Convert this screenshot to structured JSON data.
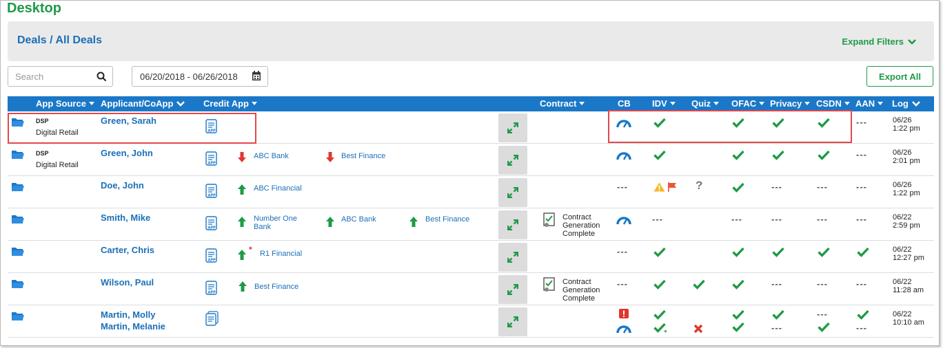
{
  "page_title": "Desktop",
  "breadcrumb": "Deals / All Deals",
  "expand_filters": "Expand Filters",
  "search_placeholder": "Search",
  "date_range": "06/20/2018 - 06/26/2018",
  "export_label": "Export All",
  "columns": {
    "app_source": "App Source",
    "applicant": "Applicant/CoApp",
    "credit_app": "Credit App",
    "contract": "Contract",
    "cb": "CB",
    "idv": "IDV",
    "quiz": "Quiz",
    "ofac": "OFAC",
    "privacy": "Privacy",
    "csdn": "CSDN",
    "aan": "AAN",
    "log": "Log"
  },
  "rows": [
    {
      "source_top": "DSP",
      "source_bottom": "Digital Retail",
      "name": "Green, Sarah",
      "name2": "",
      "lenders": [],
      "contract": "",
      "log_date": "06/26",
      "log_time": "1:22 pm"
    },
    {
      "source_top": "DSP",
      "source_bottom": "Digital Retail",
      "name": "Green, John",
      "name2": "",
      "lenders": [
        {
          "dir": "down",
          "name": "ABC Bank"
        },
        {
          "dir": "down",
          "name": "Best Finance"
        }
      ],
      "contract": "",
      "log_date": "06/26",
      "log_time": "2:01 pm"
    },
    {
      "source_top": "",
      "source_bottom": "",
      "name": "Doe, John",
      "name2": "",
      "lenders": [
        {
          "dir": "up",
          "name": "ABC Financial"
        }
      ],
      "contract": "",
      "log_date": "06/26",
      "log_time": "1:22 pm"
    },
    {
      "source_top": "",
      "source_bottom": "",
      "name": "Smith, Mike",
      "name2": "",
      "lenders": [
        {
          "dir": "up",
          "name": "Number One Bank"
        },
        {
          "dir": "up",
          "name": "ABC Bank"
        },
        {
          "dir": "up",
          "name": "Best Finance"
        }
      ],
      "contract": "Contract Generation Complete",
      "log_date": "06/22",
      "log_time": "2:59 pm"
    },
    {
      "source_top": "",
      "source_bottom": "",
      "name": "Carter, Chris",
      "name2": "",
      "lenders": [
        {
          "dir": "up",
          "name": "R1 Financial",
          "star": "*"
        }
      ],
      "contract": "",
      "log_date": "06/22",
      "log_time": "12:27 pm"
    },
    {
      "source_top": "",
      "source_bottom": "",
      "name": "Wilson, Paul",
      "name2": "",
      "lenders": [
        {
          "dir": "up",
          "name": "Best Finance"
        }
      ],
      "contract": "Contract Generation Complete",
      "log_date": "06/22",
      "log_time": "11:28 am"
    },
    {
      "source_top": "",
      "source_bottom": "",
      "name": "Martin, Molly",
      "name2": "Martin, Melanie",
      "lenders": [],
      "contract": "",
      "log_date": "06/22",
      "log_time": "10:10 am"
    }
  ],
  "status_dash": "---",
  "colors": {
    "green": "#1f9a46",
    "blue": "#1b78c8",
    "link": "#1b6fb8",
    "red": "#e0474c"
  }
}
